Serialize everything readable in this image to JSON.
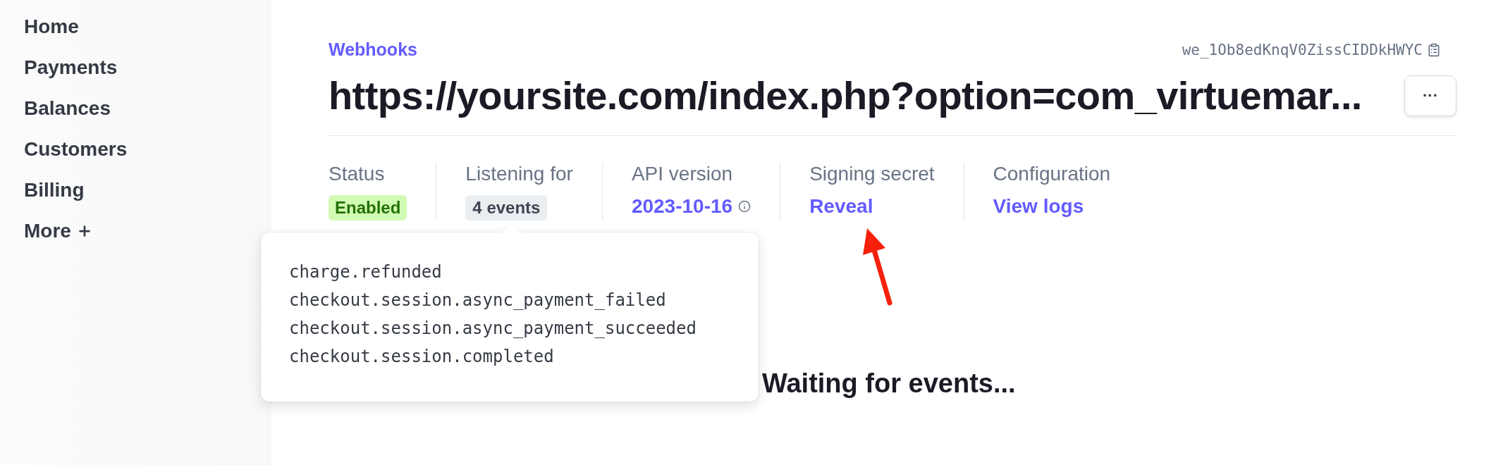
{
  "sidebar": {
    "items": [
      {
        "label": "Home"
      },
      {
        "label": "Payments"
      },
      {
        "label": "Balances"
      },
      {
        "label": "Customers"
      },
      {
        "label": "Billing"
      },
      {
        "label": "More",
        "kind": "expand"
      }
    ]
  },
  "header": {
    "breadcrumb": "Webhooks",
    "endpoint_id": "we_1Ob8edKnqV0ZissCIDDkHWYC",
    "title": "https://yoursite.com/index.php?option=com_virtuemar...",
    "more_button": "···"
  },
  "details": [
    {
      "label": "Status",
      "value": "Enabled",
      "kind": "badge"
    },
    {
      "label": "Listening for",
      "value": "4 events",
      "kind": "pill"
    },
    {
      "label": "API version",
      "value": "2023-10-16",
      "kind": "info_link"
    },
    {
      "label": "Signing secret",
      "value": "Reveal",
      "kind": "link"
    },
    {
      "label": "Configuration",
      "value": "View logs",
      "kind": "link"
    }
  ],
  "events_popover": {
    "events": [
      "charge.refunded",
      "checkout.session.async_payment_failed",
      "checkout.session.async_payment_succeeded",
      "checkout.session.completed"
    ]
  },
  "empty_state": {
    "text": "Waiting for events..."
  }
}
